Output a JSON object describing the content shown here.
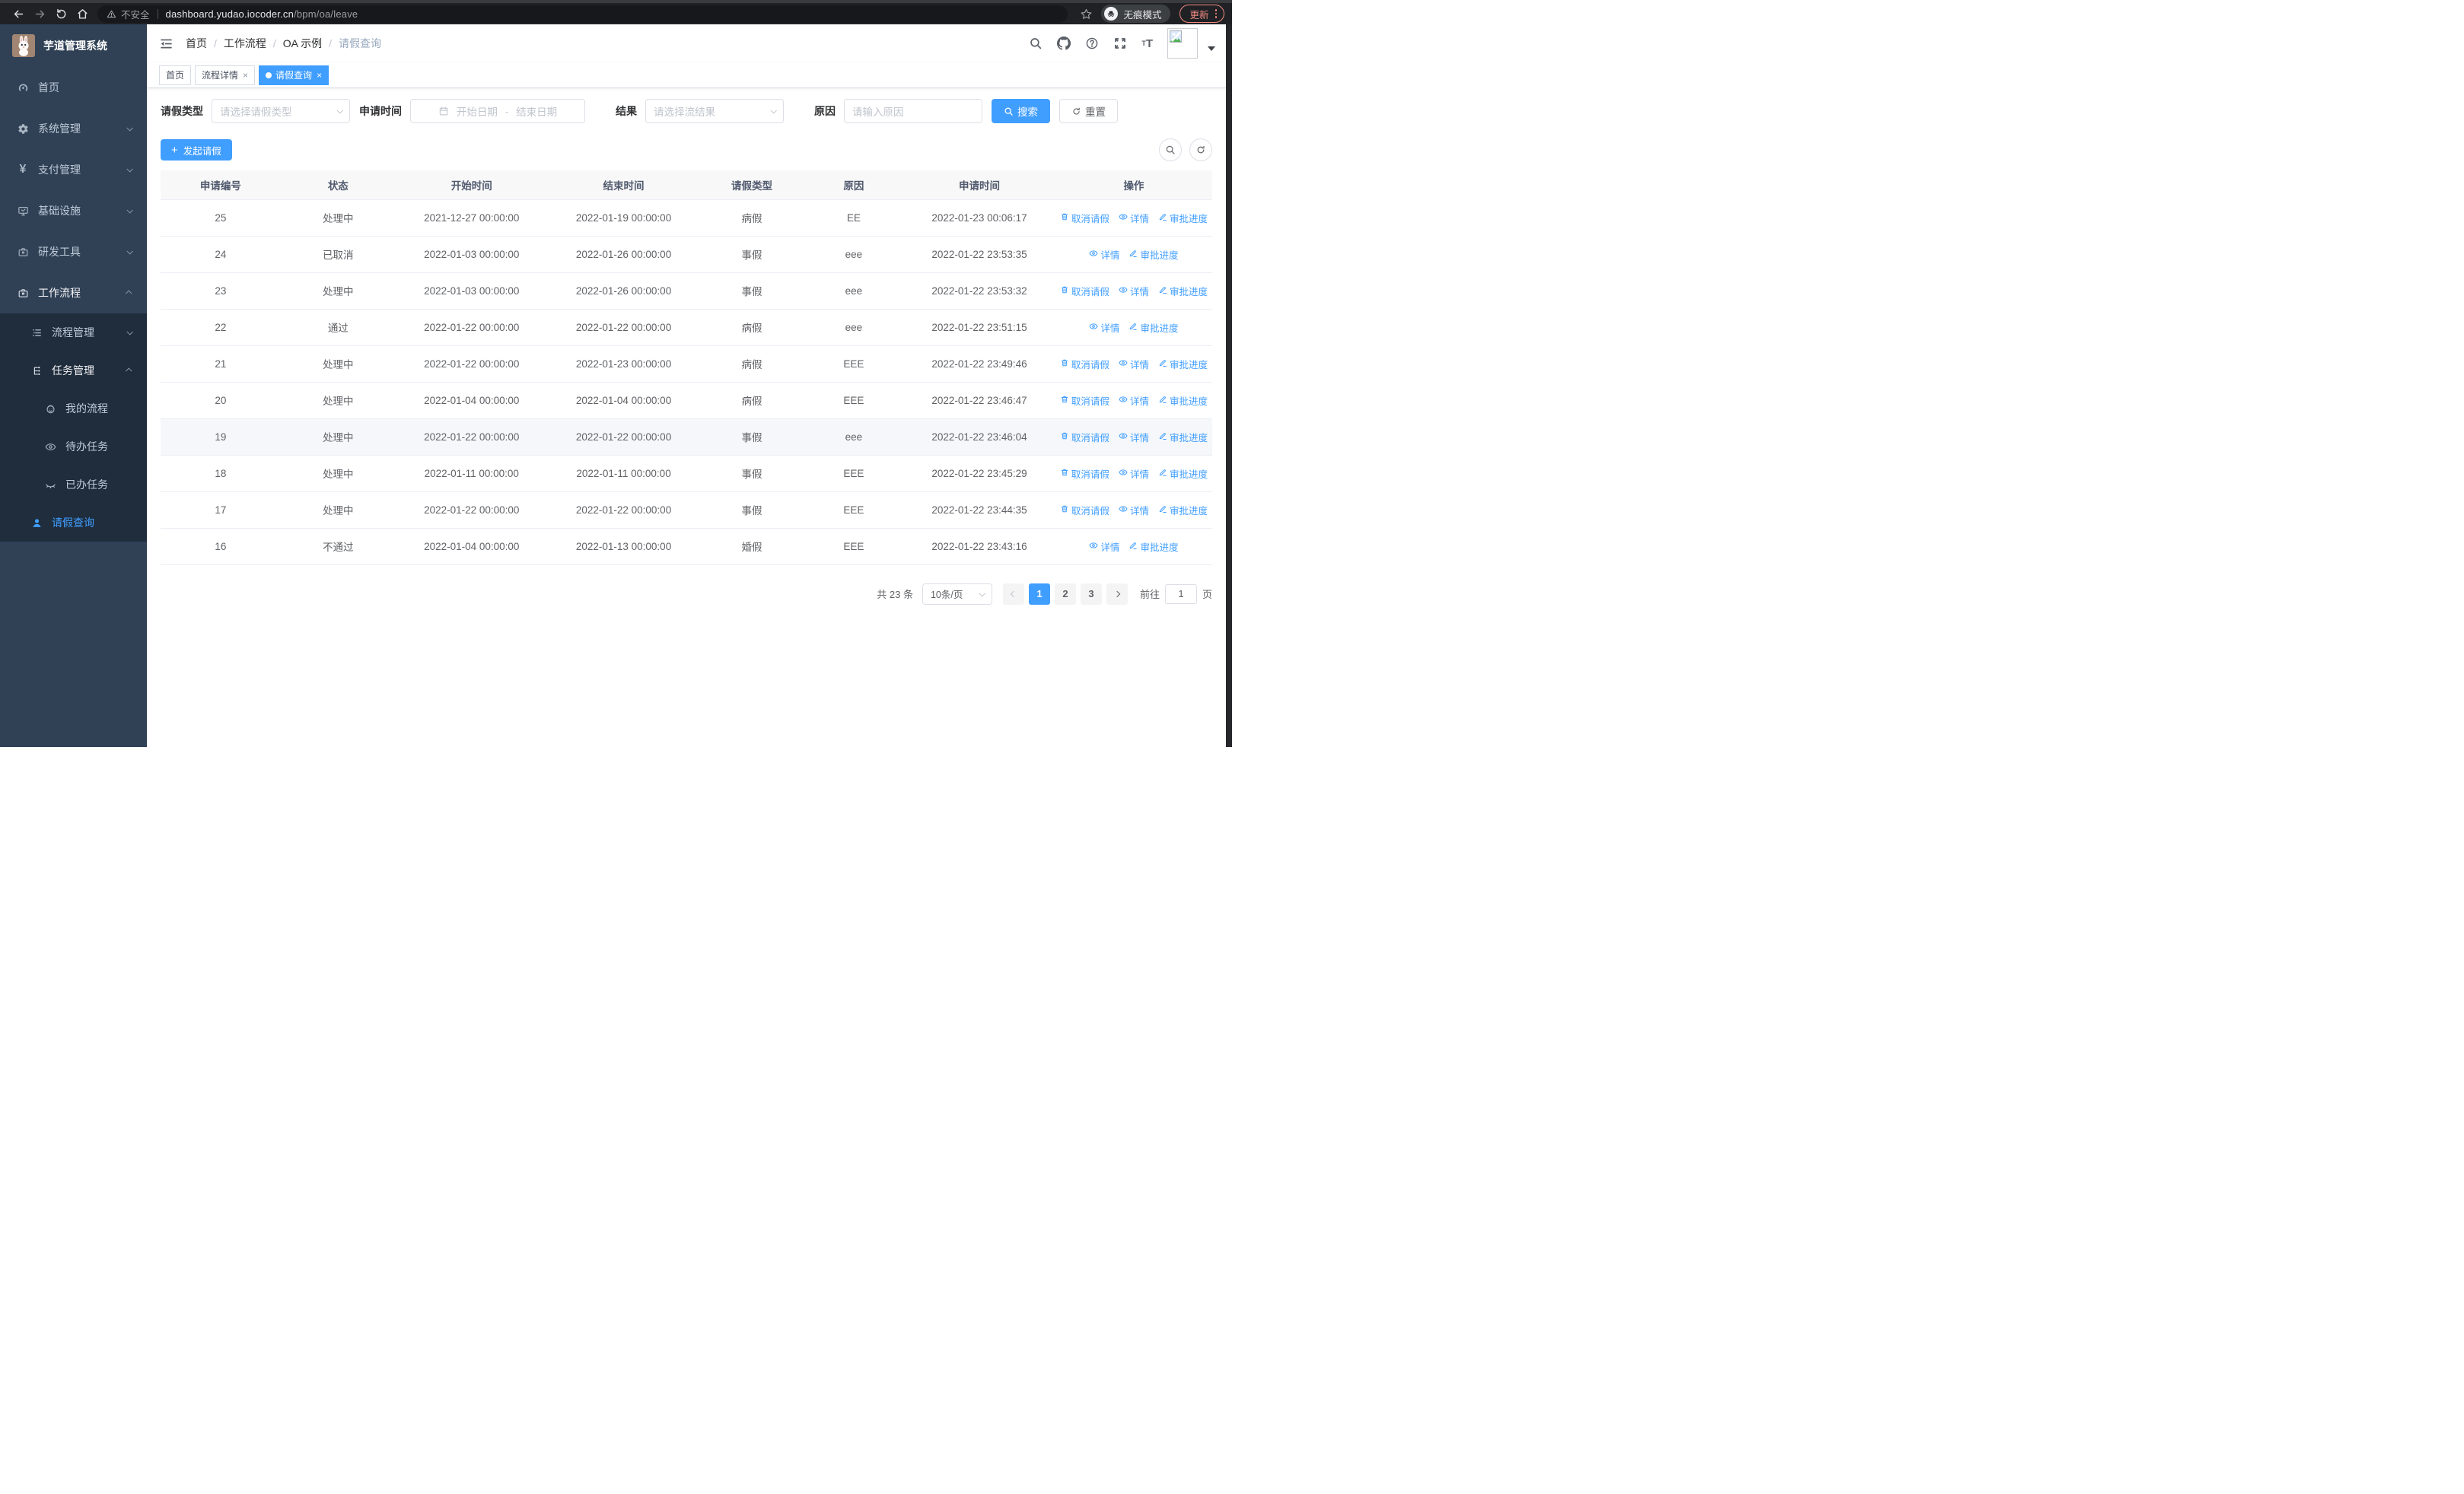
{
  "browser": {
    "security_label": "不安全",
    "url_host": "dashboard.yudao.iocoder.cn",
    "url_path": "/bpm/oa/leave",
    "incognito_label": "无痕模式",
    "update_label": "更新"
  },
  "colors": {
    "accent": "#409eff",
    "sidebar_bg": "#304156",
    "submenu_bg": "#1f2d3d",
    "update_pill": "#f28b82"
  },
  "sidebar": {
    "logo_title": "芋道管理系统",
    "menu": [
      {
        "name": "home",
        "label": "首页",
        "icon": "dashboard"
      },
      {
        "name": "system",
        "label": "系统管理",
        "icon": "gear",
        "chevron": "down"
      },
      {
        "name": "payment",
        "label": "支付管理",
        "icon": "yen",
        "chevron": "down"
      },
      {
        "name": "infra",
        "label": "基础设施",
        "icon": "monitor",
        "chevron": "down"
      },
      {
        "name": "devtools",
        "label": "研发工具",
        "icon": "briefcase",
        "chevron": "down"
      },
      {
        "name": "workflow",
        "label": "工作流程",
        "icon": "briefcase",
        "chevron": "up",
        "bright": true
      },
      {
        "name": "process-mgmt",
        "label": "流程管理",
        "icon": "list",
        "chevron": "down",
        "submenu": true
      },
      {
        "name": "task-mgmt",
        "label": "任务管理",
        "icon": "tree",
        "chevron": "up",
        "submenu": true,
        "bright": true
      },
      {
        "name": "my-process",
        "label": "我的流程",
        "icon": "face",
        "submenu": true,
        "indent": 2
      },
      {
        "name": "todo-tasks",
        "label": "待办任务",
        "icon": "eye",
        "submenu": true,
        "indent": 2
      },
      {
        "name": "done-tasks",
        "label": "已办任务",
        "icon": "eye-closed",
        "submenu": true,
        "indent": 2
      },
      {
        "name": "leave-query",
        "label": "请假查询",
        "icon": "user",
        "submenu": true,
        "active": true
      }
    ]
  },
  "breadcrumb": [
    "首页",
    "工作流程",
    "OA 示例",
    "请假查询"
  ],
  "tabs": [
    {
      "name": "home",
      "label": "首页",
      "closable": false,
      "active": false
    },
    {
      "name": "process-detail",
      "label": "流程详情",
      "closable": true,
      "active": false
    },
    {
      "name": "leave-query",
      "label": "请假查询",
      "closable": true,
      "active": true
    }
  ],
  "filters": {
    "leave_type_label": "请假类型",
    "leave_type_placeholder": "请选择请假类型",
    "apply_time_label": "申请时间",
    "start_date_placeholder": "开始日期",
    "date_separator": "-",
    "end_date_placeholder": "结束日期",
    "result_label": "结果",
    "result_placeholder": "请选择流结果",
    "reason_label": "原因",
    "reason_placeholder": "请输入原因",
    "search_button": "搜索",
    "reset_button": "重置"
  },
  "toolbar": {
    "create_button": "发起请假"
  },
  "table": {
    "columns": [
      "申请编号",
      "状态",
      "开始时间",
      "结束时间",
      "请假类型",
      "原因",
      "申请时间",
      "操作"
    ],
    "action_labels": {
      "cancel": "取消请假",
      "detail": "详情",
      "progress": "审批进度"
    },
    "rows": [
      {
        "id": "25",
        "status": "处理中",
        "start": "2021-12-27 00:00:00",
        "end": "2022-01-19 00:00:00",
        "type": "病假",
        "reason": "EE",
        "applied": "2022-01-23 00:06:17",
        "actions": [
          "cancel",
          "detail",
          "progress"
        ],
        "highlight": false
      },
      {
        "id": "24",
        "status": "已取消",
        "start": "2022-01-03 00:00:00",
        "end": "2022-01-26 00:00:00",
        "type": "事假",
        "reason": "eee",
        "applied": "2022-01-22 23:53:35",
        "actions": [
          "detail",
          "progress"
        ],
        "highlight": false
      },
      {
        "id": "23",
        "status": "处理中",
        "start": "2022-01-03 00:00:00",
        "end": "2022-01-26 00:00:00",
        "type": "事假",
        "reason": "eee",
        "applied": "2022-01-22 23:53:32",
        "actions": [
          "cancel",
          "detail",
          "progress"
        ],
        "highlight": false
      },
      {
        "id": "22",
        "status": "通过",
        "start": "2022-01-22 00:00:00",
        "end": "2022-01-22 00:00:00",
        "type": "病假",
        "reason": "eee",
        "applied": "2022-01-22 23:51:15",
        "actions": [
          "detail",
          "progress"
        ],
        "highlight": false
      },
      {
        "id": "21",
        "status": "处理中",
        "start": "2022-01-22 00:00:00",
        "end": "2022-01-23 00:00:00",
        "type": "病假",
        "reason": "EEE",
        "applied": "2022-01-22 23:49:46",
        "actions": [
          "cancel",
          "detail",
          "progress"
        ],
        "highlight": false
      },
      {
        "id": "20",
        "status": "处理中",
        "start": "2022-01-04 00:00:00",
        "end": "2022-01-04 00:00:00",
        "type": "病假",
        "reason": "EEE",
        "applied": "2022-01-22 23:46:47",
        "actions": [
          "cancel",
          "detail",
          "progress"
        ],
        "highlight": false
      },
      {
        "id": "19",
        "status": "处理中",
        "start": "2022-01-22 00:00:00",
        "end": "2022-01-22 00:00:00",
        "type": "事假",
        "reason": "eee",
        "applied": "2022-01-22 23:46:04",
        "actions": [
          "cancel",
          "detail",
          "progress"
        ],
        "highlight": true
      },
      {
        "id": "18",
        "status": "处理中",
        "start": "2022-01-11 00:00:00",
        "end": "2022-01-11 00:00:00",
        "type": "事假",
        "reason": "EEE",
        "applied": "2022-01-22 23:45:29",
        "actions": [
          "cancel",
          "detail",
          "progress"
        ],
        "highlight": false
      },
      {
        "id": "17",
        "status": "处理中",
        "start": "2022-01-22 00:00:00",
        "end": "2022-01-22 00:00:00",
        "type": "事假",
        "reason": "EEE",
        "applied": "2022-01-22 23:44:35",
        "actions": [
          "cancel",
          "detail",
          "progress"
        ],
        "highlight": false
      },
      {
        "id": "16",
        "status": "不通过",
        "start": "2022-01-04 00:00:00",
        "end": "2022-01-13 00:00:00",
        "type": "婚假",
        "reason": "EEE",
        "applied": "2022-01-22 23:43:16",
        "actions": [
          "detail",
          "progress"
        ],
        "highlight": false
      }
    ]
  },
  "pagination": {
    "total_text": "共 23 条",
    "page_size": "10条/页",
    "pages": [
      "1",
      "2",
      "3"
    ],
    "active_page": "1",
    "goto_label": "前往",
    "goto_value": "1",
    "page_unit": "页"
  }
}
